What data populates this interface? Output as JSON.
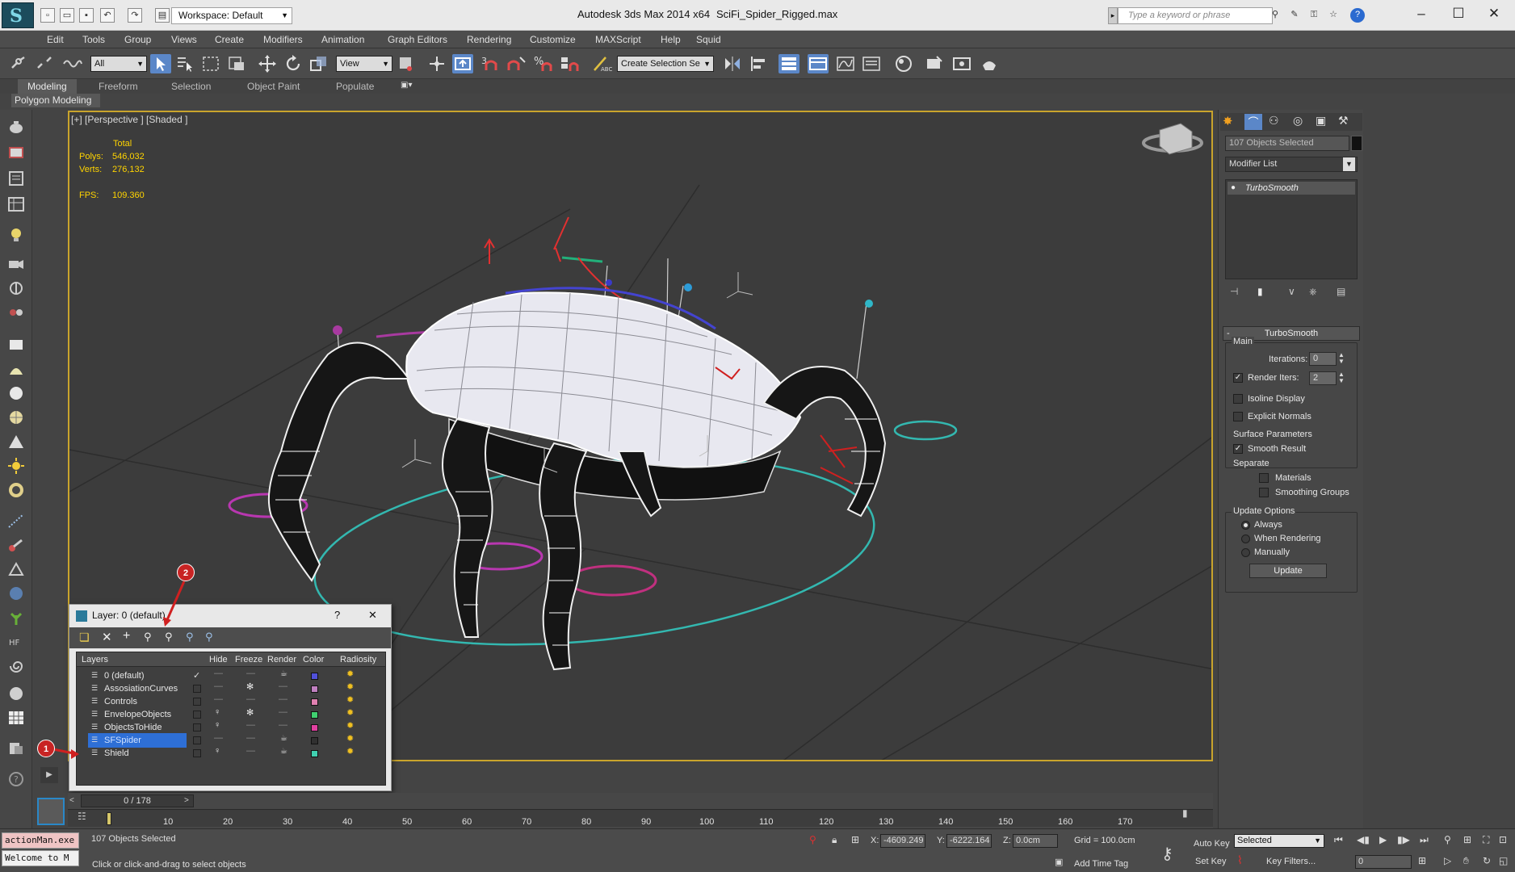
{
  "title_bar": {
    "workspace": "Workspace: Default",
    "app_name": "Autodesk 3ds Max  2014 x64",
    "file_name": "SciFi_Spider_Rigged.max",
    "search_placeholder": "Type a keyword or phrase"
  },
  "menu": [
    "Edit",
    "Tools",
    "Group",
    "Views",
    "Create",
    "Modifiers",
    "Animation",
    "Graph Editors",
    "Rendering",
    "Customize",
    "MAXScript",
    "Help",
    "Squid"
  ],
  "toolbar": {
    "filter_select": "All",
    "refcoord_select": "View",
    "selection_set": "Create Selection Se",
    "snap_labels": [
      "3",
      "%"
    ]
  },
  "ribbon": {
    "tabs": [
      "Modeling",
      "Freeform",
      "Selection",
      "Object Paint",
      "Populate"
    ],
    "active_tab": "Modeling",
    "panel": "Polygon Modeling"
  },
  "viewport": {
    "label": "[+] [Perspective ] [Shaded ]",
    "stats": {
      "header": "Total",
      "polys_label": "Polys:",
      "polys_value": "546,032",
      "verts_label": "Verts:",
      "verts_value": "276,132",
      "fps_label": "FPS:",
      "fps_value": "109.360"
    }
  },
  "command_panel": {
    "selection_count": "107 Objects Selected",
    "modifier_list": "Modifier List",
    "modifier_stack": [
      "TurboSmooth"
    ],
    "rollout_title": "TurboSmooth",
    "main_group": "Main",
    "iterations_label": "Iterations:",
    "iterations_value": "0",
    "render_iters_label": "Render Iters:",
    "render_iters_value": "2",
    "render_iters_checked": true,
    "isoline_label": "Isoline Display",
    "explicit_normals_label": "Explicit Normals",
    "surface_params_label": "Surface Parameters",
    "smooth_result_label": "Smooth Result",
    "smooth_result_checked": true,
    "separate_label": "Separate",
    "materials_label": "Materials",
    "smoothing_groups_label": "Smoothing Groups",
    "update_options_label": "Update Options",
    "update_options": [
      "Always",
      "When Rendering",
      "Manually"
    ],
    "update_selected": "Always",
    "update_button": "Update"
  },
  "layer_dialog": {
    "title": "Layer: 0 (default)",
    "help": "?",
    "close": "✕",
    "columns": [
      "Layers",
      "Hide",
      "Freeze",
      "Render",
      "Color",
      "Radiosity"
    ],
    "layers": [
      {
        "name": "0 (default)",
        "current": true,
        "color": "#5050d8"
      },
      {
        "name": "AssosiationCurves",
        "current": false,
        "color": "#c080c0"
      },
      {
        "name": "Controls",
        "current": false,
        "color": "#e080b0"
      },
      {
        "name": "EnvelopeObjects",
        "current": false,
        "color": "#40d070"
      },
      {
        "name": "ObjectsToHide",
        "current": false,
        "color": "#e040a0"
      },
      {
        "name": "SFSpider",
        "current": false,
        "color": "#303030",
        "selected": true
      },
      {
        "name": "Shield",
        "current": false,
        "color": "#40d0b0"
      }
    ]
  },
  "callouts": [
    "1",
    "2"
  ],
  "timeline": {
    "frame_display": "0 / 178",
    "ticks": [
      "10",
      "20",
      "30",
      "40",
      "50",
      "60",
      "70",
      "80",
      "90",
      "100",
      "110",
      "120",
      "130",
      "140",
      "150",
      "160",
      "170"
    ]
  },
  "status": {
    "maxscript_top": "actionMan.exe",
    "maxscript_bottom": "Welcome to M",
    "selection": "107 Objects Selected",
    "prompt": "Click or click-and-drag to select objects",
    "x_label": "X:",
    "x_value": "-4609.249",
    "y_label": "Y:",
    "y_value": "-6222.164",
    "z_label": "Z:",
    "z_value": "0.0cm",
    "grid": "Grid = 100.0cm",
    "add_time_tag": "Add Time Tag",
    "auto_key": "Auto Key",
    "set_key": "Set Key",
    "selected_filter": "Selected",
    "key_filters": "Key Filters...",
    "frame_field": "0"
  },
  "colors": {
    "viewport_border": "#c9a42c",
    "stats_text": "#ffd400",
    "selection_highlight": "#2e6fd6",
    "callout": "#c82424"
  }
}
